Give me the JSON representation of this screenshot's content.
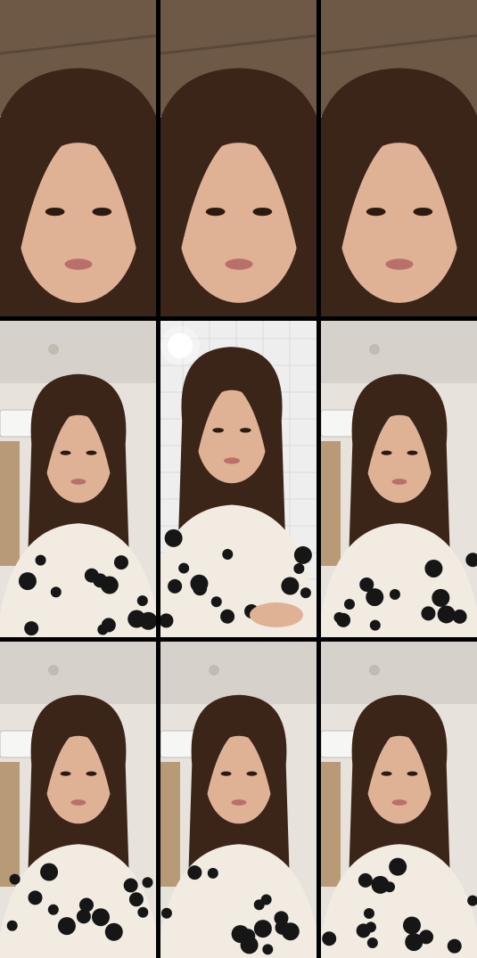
{
  "collage": {
    "rows": 3,
    "cols": 3,
    "frames": [
      {
        "scene": "closeup-headboard",
        "variant": 1
      },
      {
        "scene": "closeup-hand-hair",
        "variant": 2
      },
      {
        "scene": "closeup-pajama",
        "variant": 3
      },
      {
        "scene": "room-ac",
        "variant": 4
      },
      {
        "scene": "bathroom-light",
        "variant": 5
      },
      {
        "scene": "room-hand-chest",
        "variant": 6
      },
      {
        "scene": "room-hair-touch",
        "variant": 7
      },
      {
        "scene": "room-halfup",
        "variant": 8
      },
      {
        "scene": "room-holding-card",
        "variant": 9
      }
    ]
  },
  "colors": {
    "divider": "#000000",
    "hair": "#3b2418",
    "skin": "#e0b295",
    "pajama": "#f1ebe2",
    "dot": "#161616",
    "wood": "#6e5947",
    "wall": "#e7e2dc",
    "ceiling": "#d6d1cb"
  }
}
